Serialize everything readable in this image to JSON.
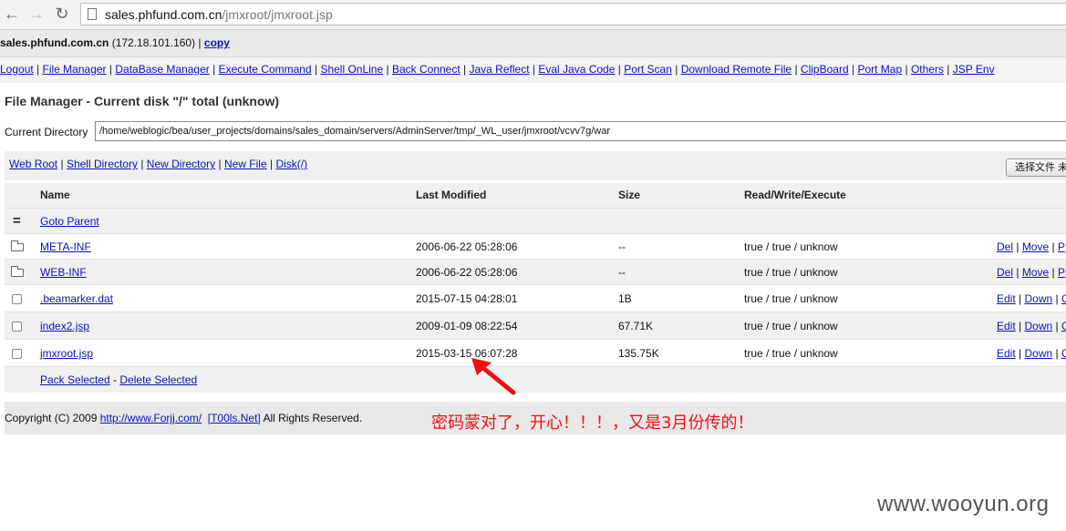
{
  "browser": {
    "url_host": "sales.phfund.com.cn",
    "url_path": "/jmxroot/jmxroot.jsp",
    "back_icon": "arrow-left-icon",
    "forward_icon": "arrow-right-icon",
    "reload_icon": "reload-icon"
  },
  "hostbar": {
    "host": "sales.phfund.com.cn",
    "ip": " (172.18.101.160) | ",
    "copy_label": "copy"
  },
  "menu": [
    "Logout",
    "File Manager",
    "DataBase Manager",
    "Execute Command",
    "Shell OnLine",
    "Back Connect",
    "Java Reflect",
    "Eval Java Code",
    "Port Scan",
    "Download Remote File",
    "ClipBoard",
    "Port Map",
    "Others",
    "JSP Env"
  ],
  "title": "File Manager - Current disk \"/\" total (unknow)",
  "current_dir": {
    "label": "Current Directory",
    "value": "/home/weblogic/bea/user_projects/domains/sales_domain/servers/AdminServer/tmp/_WL_user/jmxroot/vcvv7g/war"
  },
  "quick_links": [
    "Web Root",
    "Shell Directory",
    "New Directory",
    "New File",
    "Disk(/)"
  ],
  "upload": {
    "choose_label": "选择文件",
    "choose_tail": "未"
  },
  "table": {
    "headers": {
      "name": "Name",
      "modified": "Last Modified",
      "size": "Size",
      "rwx": "Read/Write/Execute"
    },
    "parent": {
      "icon": "=",
      "label": "Goto Parent"
    },
    "rows": [
      {
        "kind": "folder",
        "name": "META-INF",
        "modified": "2006-06-22 05:28:06",
        "size": "--",
        "rwx": "true / true / unknow",
        "a1": "Del",
        "a2": "Move",
        "a3": "P"
      },
      {
        "kind": "folder",
        "name": "WEB-INF",
        "modified": "2006-06-22 05:28:06",
        "size": "--",
        "rwx": "true / true / unknow",
        "a1": "Del",
        "a2": "Move",
        "a3": "P"
      },
      {
        "kind": "file",
        "name": ".beamarker.dat",
        "modified": "2015-07-15 04:28:01",
        "size": "1B",
        "rwx": "true / true / unknow",
        "a1": "Edit",
        "a2": "Down",
        "a3": "C"
      },
      {
        "kind": "file",
        "name": "index2.jsp",
        "modified": "2009-01-09 08:22:54",
        "size": "67.71K",
        "rwx": "true / true / unknow",
        "a1": "Edit",
        "a2": "Down",
        "a3": "C"
      },
      {
        "kind": "file",
        "name": "jmxroot.jsp",
        "modified": "2015-03-15 06:07:28",
        "size": "135.75K",
        "rwx": "true / true / unknow",
        "a1": "Edit",
        "a2": "Down",
        "a3": "C"
      }
    ],
    "pack_selected": "Pack Selected",
    "delete_selected": "Delete Selected"
  },
  "footer": {
    "prefix": "Copyright (C) 2009 ",
    "site_link": "http://www.Forjj.com/",
    "tools_link": "[T00ls.Net]",
    "suffix": " All Rights Reserved."
  },
  "annotation": "密码蒙对了，开心！！！，又是3月份传的！",
  "watermark": "www.wooyun.org",
  "colors": {
    "link": "#0b12b8",
    "annotation": "#e11111"
  }
}
